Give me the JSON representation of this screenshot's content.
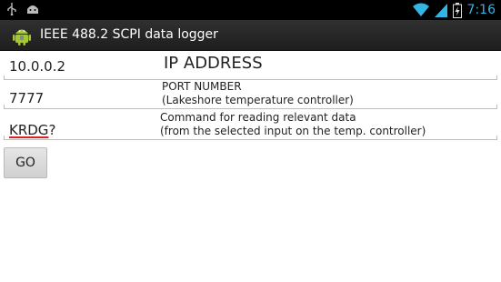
{
  "status_bar": {
    "time": "7:16",
    "icons": [
      "usb-icon",
      "android-debug-icon",
      "wifi-icon",
      "signal-icon",
      "battery-charging-icon"
    ],
    "time_color": "#33b5e5"
  },
  "action_bar": {
    "title": "IEEE 488.2 SCPI data logger",
    "icon": "android-app-icon"
  },
  "form": {
    "ip": {
      "value": "10.0.0.2",
      "label": "IP ADDRESS"
    },
    "port": {
      "value": "7777",
      "label_line1": "PORT NUMBER",
      "label_line2": "(Lakeshore temperature controller)"
    },
    "command": {
      "value_main": "KRDG",
      "value_suffix": "?",
      "label_line1": "Command for reading relevant data",
      "label_line2": "(from the selected input on the temp. controller)"
    }
  },
  "go_button": {
    "label": "GO"
  },
  "colors": {
    "accent": "#33b5e5",
    "spellcheck": "#e02020"
  }
}
